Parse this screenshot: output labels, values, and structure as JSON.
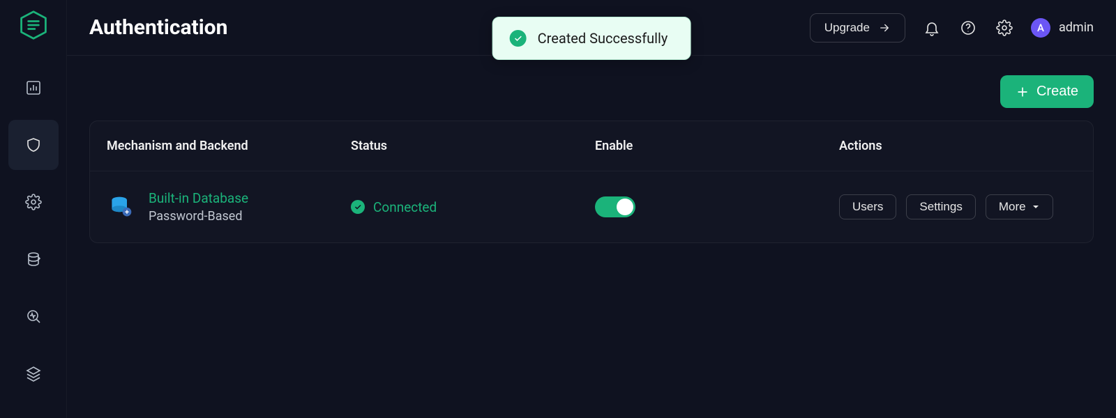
{
  "header": {
    "title": "Authentication",
    "upgrade_label": "Upgrade",
    "username": "admin",
    "avatar_initial": "A"
  },
  "toast": {
    "message": "Created Successfully"
  },
  "buttons": {
    "create_label": "Create"
  },
  "table": {
    "columns": {
      "mechanism": "Mechanism and Backend",
      "status": "Status",
      "enable": "Enable",
      "actions": "Actions"
    },
    "rows": [
      {
        "name": "Built-in Database",
        "subtitle": "Password-Based",
        "status": "Connected",
        "enabled": true,
        "actions": {
          "users": "Users",
          "settings": "Settings",
          "more": "More"
        }
      }
    ]
  },
  "sidebar": {
    "items": [
      "dashboard",
      "security",
      "settings",
      "sync",
      "diagnostics",
      "layers"
    ]
  }
}
